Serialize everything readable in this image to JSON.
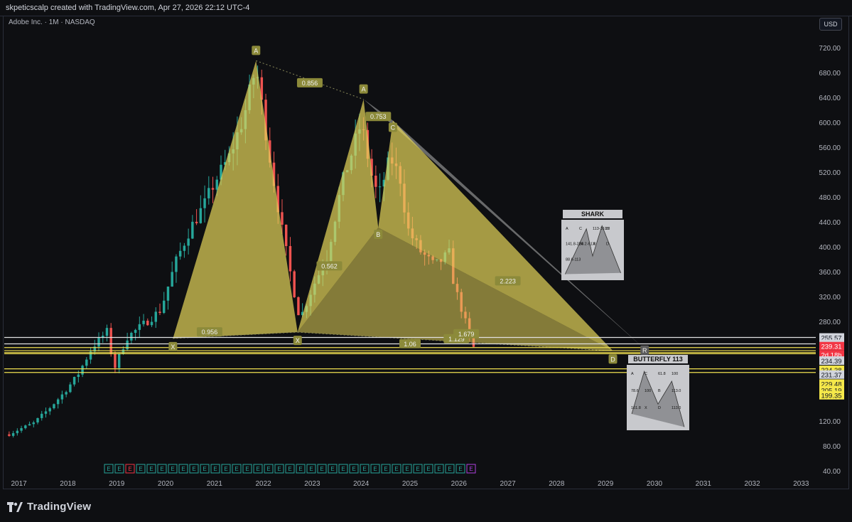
{
  "header": {
    "attribution": "skpeticscalp created with TradingView.com, Apr 27, 2026 22:12 UTC-4"
  },
  "symbol_line": "Adobe Inc. · 1M · NASDAQ",
  "currency_button": "USD",
  "brand": "TradingView",
  "colors": {
    "background": "#0e0f12",
    "up": "#26a69a",
    "down": "#ef5350",
    "pattern_fill": "#e6d65a",
    "shark_fill": "#9a9a9a",
    "level_yellow": "#f0e050",
    "level_white": "#e0e0e0"
  },
  "chart_data": {
    "type": "candlestick",
    "symbol": "Adobe Inc.",
    "interval": "1M",
    "exchange": "NASDAQ",
    "currency": "USD",
    "x_tick_labels": [
      "2017",
      "2018",
      "2019",
      "2020",
      "2021",
      "2022",
      "2023",
      "2024",
      "2025",
      "2026",
      "2027",
      "2028",
      "2029",
      "2030",
      "2031",
      "2032",
      "2033"
    ],
    "y_tick_labels": [
      "40.00",
      "80.00",
      "120.00",
      "160.00",
      "200.00",
      "240.00",
      "280.00",
      "320.00",
      "360.00",
      "400.00",
      "440.00",
      "480.00",
      "520.00",
      "560.00",
      "600.00",
      "640.00",
      "680.00",
      "720.00"
    ],
    "y_range": [
      30,
      745
    ],
    "x_range": [
      2016.7,
      2033.3
    ],
    "price_path": [
      [
        2016.8,
        100
      ],
      [
        2017.0,
        108
      ],
      [
        2017.3,
        118
      ],
      [
        2017.6,
        140
      ],
      [
        2017.9,
        165
      ],
      [
        2018.2,
        195
      ],
      [
        2018.5,
        240
      ],
      [
        2018.8,
        265
      ],
      [
        2018.95,
        205
      ],
      [
        2019.2,
        255
      ],
      [
        2019.6,
        280
      ],
      [
        2019.9,
        300
      ],
      [
        2020.2,
        375
      ],
      [
        2020.5,
        430
      ],
      [
        2020.8,
        470
      ],
      [
        2021.0,
        505
      ],
      [
        2021.3,
        545
      ],
      [
        2021.6,
        610
      ],
      [
        2021.85,
        690
      ],
      [
        2022.1,
        560
      ],
      [
        2022.4,
        420
      ],
      [
        2022.6,
        340
      ],
      [
        2022.75,
        285
      ],
      [
        2023.0,
        335
      ],
      [
        2023.3,
        385
      ],
      [
        2023.6,
        500
      ],
      [
        2023.9,
        575
      ],
      [
        2024.0,
        600
      ],
      [
        2024.2,
        520
      ],
      [
        2024.35,
        480
      ],
      [
        2024.6,
        545
      ],
      [
        2024.8,
        510
      ],
      [
        2024.95,
        430
      ],
      [
        2025.2,
        395
      ],
      [
        2025.5,
        370
      ],
      [
        2025.8,
        390
      ],
      [
        2025.9,
        340
      ],
      [
        2026.1,
        290
      ],
      [
        2026.25,
        245
      ],
      [
        2026.3,
        239.31
      ]
    ],
    "patterns": {
      "cypher_points": [
        {
          "label": "X",
          "x": 2020.15,
          "y": 254
        },
        {
          "label": "A",
          "x": 2021.85,
          "y": 700
        },
        {
          "label": "X",
          "x": 2022.7,
          "y": 264
        },
        {
          "label": "A",
          "x": 2024.05,
          "y": 638
        },
        {
          "label": "B",
          "x": 2024.35,
          "y": 432
        },
        {
          "label": "C",
          "x": 2024.65,
          "y": 604
        },
        {
          "label": "D",
          "x": 2029.15,
          "y": 234
        }
      ],
      "shark_point": {
        "label": "R",
        "x": 2029.8,
        "y": 237
      },
      "ratios": [
        {
          "text": "0.856",
          "x": 2022.95,
          "y": 664
        },
        {
          "text": "0.753",
          "x": 2024.35,
          "y": 610
        },
        {
          "text": "0.956",
          "x": 2020.9,
          "y": 264
        },
        {
          "text": "0.562",
          "x": 2023.35,
          "y": 370
        },
        {
          "text": "2.223",
          "x": 2027.0,
          "y": 346
        },
        {
          "text": "1.06",
          "x": 2025.0,
          "y": 245
        },
        {
          "text": "1.129",
          "x": 2025.95,
          "y": 253
        },
        {
          "text": "1.679",
          "x": 2026.15,
          "y": 261
        }
      ]
    },
    "horizontal_levels": [
      {
        "value": 255.57,
        "color": "#e0e0e0"
      },
      {
        "value": 245.28,
        "color": "#e0e0e0"
      },
      {
        "value": 239.31,
        "color": "#f0e050"
      },
      {
        "value": 234.39,
        "color": "#f0e050"
      },
      {
        "value": 231.37,
        "color": "#f0e050"
      },
      {
        "value": 229.48,
        "color": "#f0e050"
      },
      {
        "value": 205.19,
        "color": "#f0e050"
      },
      {
        "value": 199.35,
        "color": "#f0e050"
      }
    ],
    "price_tags": [
      {
        "text": "255.57",
        "bg": "#d1d4dc",
        "fg": "#131722"
      },
      {
        "text": "245.28",
        "bg": "#d1d4dc",
        "fg": "#131722"
      },
      {
        "text": "239.31",
        "bg": "#f23645",
        "fg": "#ffffff"
      },
      {
        "text": "2d 18h",
        "bg": "#f23645",
        "fg": "#ffffff"
      },
      {
        "text": "234.39",
        "bg": "#d1d4dc",
        "fg": "#131722"
      },
      {
        "text": "234.38",
        "bg": "#f5e84a",
        "fg": "#131722"
      },
      {
        "text": "231.37",
        "bg": "#d1d4dc",
        "fg": "#131722"
      },
      {
        "text": "229.48",
        "bg": "#f5e84a",
        "fg": "#131722"
      },
      {
        "text": "205.19",
        "bg": "#f5e84a",
        "fg": "#131722"
      },
      {
        "text": "199.35",
        "bg": "#f5e84a",
        "fg": "#131722"
      }
    ],
    "earnings_markers": {
      "count": 35,
      "letter": "E",
      "highlight_index_red": 2,
      "last_is_purple": true
    },
    "insets": [
      {
        "title": "SHARK",
        "labels": [
          "A",
          "C",
          "113-161.8",
          "B",
          "141.8-224",
          "38.2-61.8",
          "X",
          "D",
          "88.6-113"
        ]
      },
      {
        "title": "BUTTERFLY 113",
        "labels": [
          "A",
          "C",
          "61.8",
          "100",
          "78.6",
          "100",
          "B",
          "113.0",
          "161.8",
          "X",
          "D",
          "113.0"
        ]
      }
    ]
  }
}
